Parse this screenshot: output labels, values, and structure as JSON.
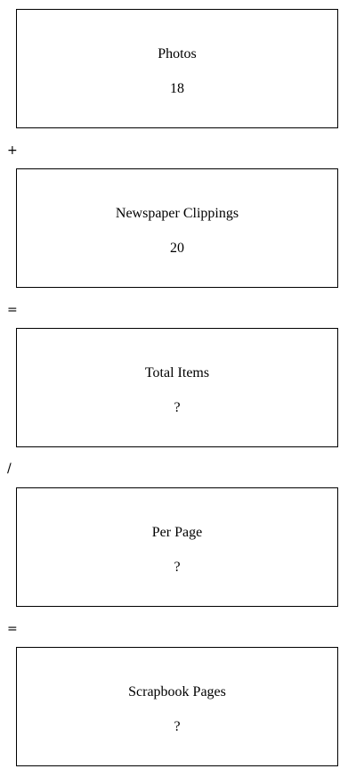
{
  "boxes": [
    {
      "label": "Photos",
      "value": "18"
    },
    {
      "label": "Newspaper Clippings",
      "value": "20"
    },
    {
      "label": "Total Items",
      "value": "?"
    },
    {
      "label": "Per Page",
      "value": "?"
    },
    {
      "label": "Scrapbook Pages",
      "value": "?"
    }
  ],
  "operators": [
    "+",
    "=",
    "/",
    "="
  ]
}
